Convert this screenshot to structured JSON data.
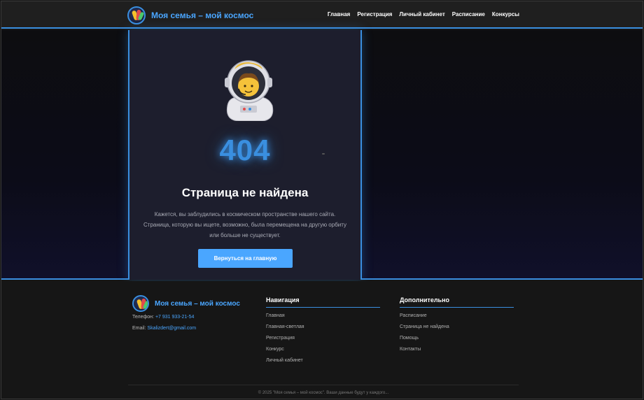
{
  "header": {
    "logo_text": "Моя семья – мой космос",
    "nav": [
      "Главная",
      "Регистрация",
      "Личный кабинет",
      "Расписание",
      "Конкурсы"
    ]
  },
  "error": {
    "code": "404",
    "title": "Страница не найдена",
    "description": "Кажется, вы заблудились в космическом пространстве нашего сайта. Страница, которую вы ищете, возможно, была перемещена на другую орбиту или больше не существует.",
    "button_label": "Вернуться на главную",
    "icon": "astronaut-icon"
  },
  "footer": {
    "logo_text": "Моя семья – мой космос",
    "phone_label": "Телефон:",
    "phone": "+7 931 933-21-54",
    "email_label": "Email:",
    "email": "Skalizdert@gmail.com",
    "nav_title": "Навигация",
    "nav_links": [
      "Главная",
      "Главная-светлая",
      "Регистрация",
      "Конкурс",
      "Личный кабинет"
    ],
    "extra_title": "Дополнительно",
    "extra_links": [
      "Расписание",
      "Страница не найдена",
      "Помощь",
      "Контакты"
    ],
    "copyright": "© 2025 \"Моя семья – мой космос\". Ваши данные будут у каждого..."
  },
  "colors": {
    "accent": "#3a8fe0",
    "button": "#4aa6ff",
    "background": "#161616",
    "card": "#1d1e2d"
  }
}
